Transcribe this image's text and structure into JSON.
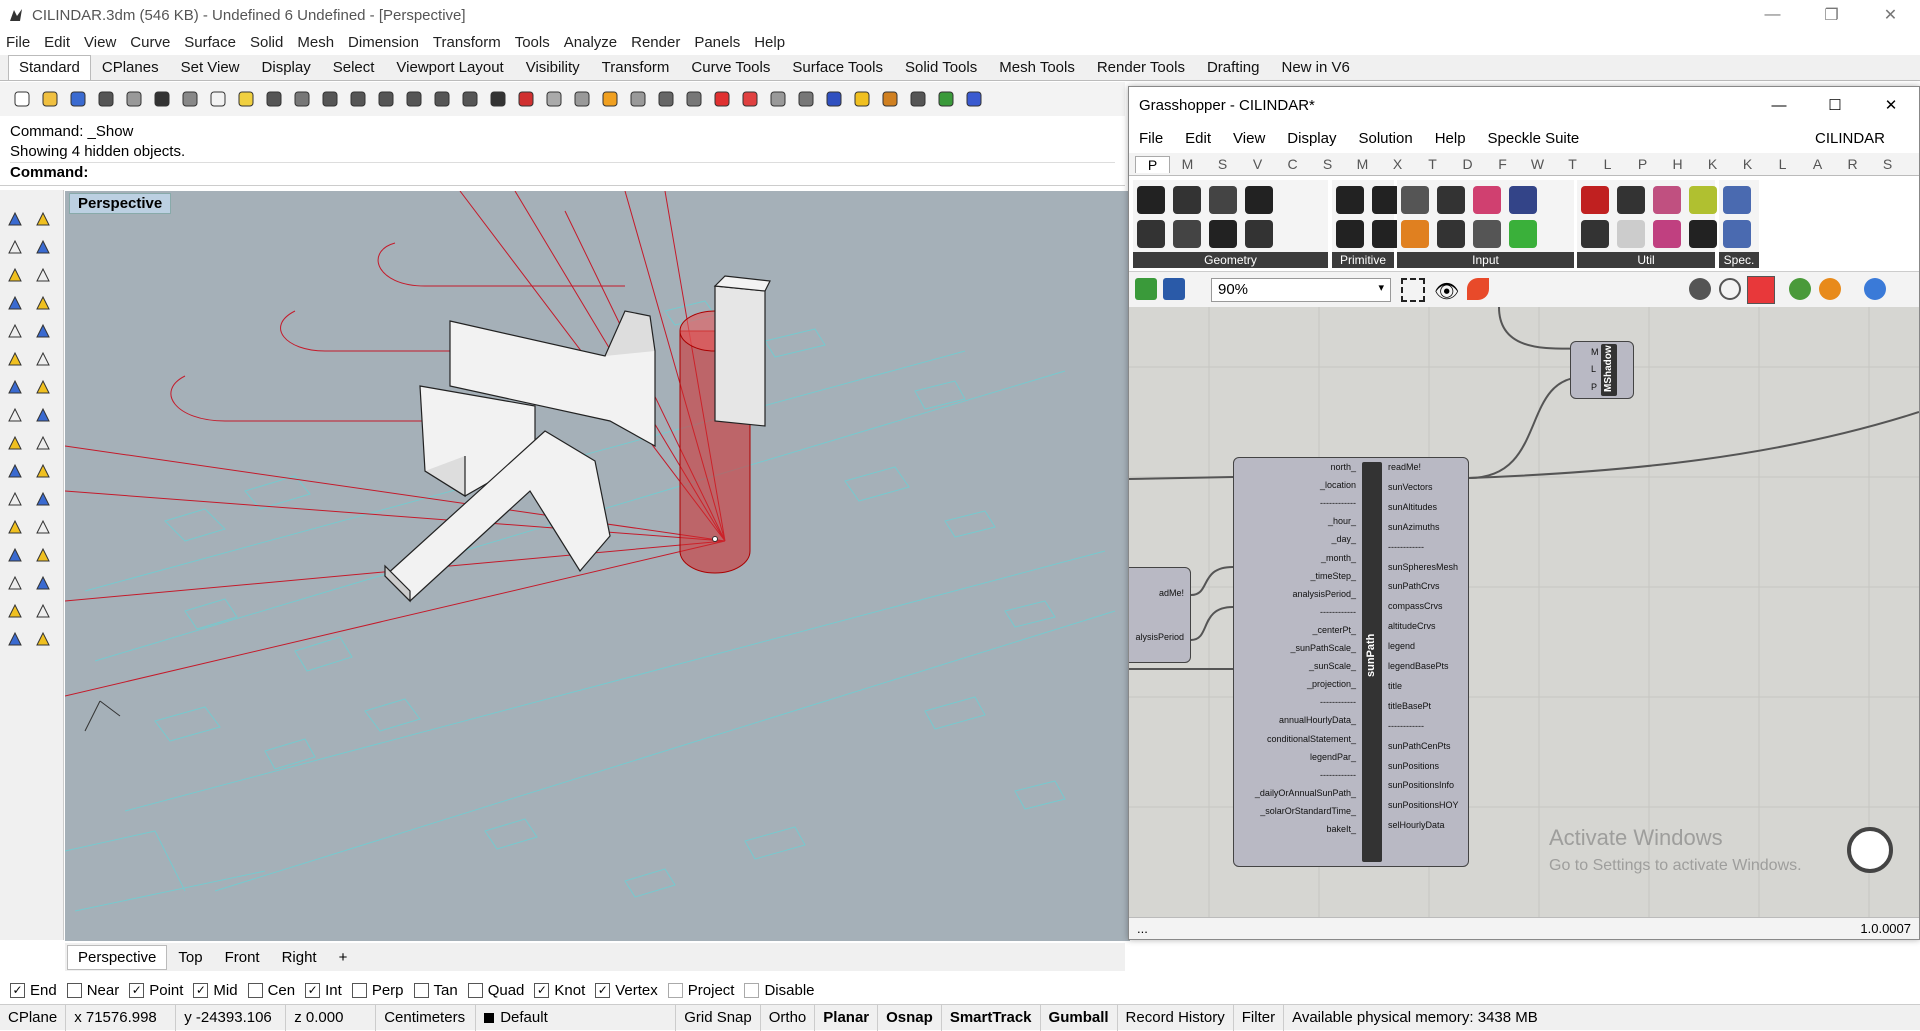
{
  "window": {
    "title": "CILINDAR.3dm (546 KB) - Undefined 6 Undefined - [Perspective]"
  },
  "menu": [
    "File",
    "Edit",
    "View",
    "Curve",
    "Surface",
    "Solid",
    "Mesh",
    "Dimension",
    "Transform",
    "Tools",
    "Analyze",
    "Render",
    "Panels",
    "Help"
  ],
  "tabs": [
    "Standard",
    "CPlanes",
    "Set View",
    "Display",
    "Select",
    "Viewport Layout",
    "Visibility",
    "Transform",
    "Curve Tools",
    "Surface Tools",
    "Solid Tools",
    "Mesh Tools",
    "Render Tools",
    "Drafting",
    "New in V6"
  ],
  "command": {
    "line1": "Command: _Show",
    "line2": "Showing 4 hidden objects.",
    "prompt": "Command:"
  },
  "viewport": {
    "label": "Perspective"
  },
  "viewport_tabs": [
    "Perspective",
    "Top",
    "Front",
    "Right",
    "+"
  ],
  "osnaps": [
    {
      "label": "End",
      "checked": true
    },
    {
      "label": "Near",
      "checked": false
    },
    {
      "label": "Point",
      "checked": true
    },
    {
      "label": "Mid",
      "checked": true
    },
    {
      "label": "Cen",
      "checked": false
    },
    {
      "label": "Int",
      "checked": true
    },
    {
      "label": "Perp",
      "checked": false
    },
    {
      "label": "Tan",
      "checked": false
    },
    {
      "label": "Quad",
      "checked": false
    },
    {
      "label": "Knot",
      "checked": true
    },
    {
      "label": "Vertex",
      "checked": true
    },
    {
      "label": "Project",
      "checked": false
    },
    {
      "label": "Disable",
      "checked": false
    }
  ],
  "status": {
    "cplane": "CPlane",
    "x": "x 71576.998",
    "y": "y -24393.106",
    "z": "z 0.000",
    "units": "Centimeters",
    "layer": "Default",
    "toggles": [
      "Grid Snap",
      "Ortho",
      "Planar",
      "Osnap",
      "SmartTrack",
      "Gumball",
      "Record History",
      "Filter"
    ],
    "bold_toggles": [
      "Planar",
      "Osnap",
      "SmartTrack",
      "Gumball"
    ],
    "memory": "Available physical memory: 3438 MB"
  },
  "grasshopper": {
    "title": "Grasshopper - CILINDAR*",
    "menu": [
      "File",
      "Edit",
      "View",
      "Display",
      "Solution",
      "Help",
      "Speckle Suite"
    ],
    "doc": "CILINDAR",
    "category_tabs": [
      "P",
      "M",
      "S",
      "V",
      "C",
      "S",
      "M",
      "X",
      "T",
      "D",
      "F",
      "W",
      "T",
      "L",
      "P",
      "H",
      "K",
      "K",
      "L",
      "A",
      "R",
      "S"
    ],
    "ribbon_groups": [
      "Geometry",
      "Primitive",
      "Input",
      "Util",
      "Spec."
    ],
    "zoom": "90%",
    "version": "1.0.0007",
    "footer_left": "...",
    "sunpath": {
      "name": "sunPath",
      "inputs": [
        "north_",
        "_location",
        "------------",
        "_hour_",
        "_day_",
        "_month_",
        "_timeStep_",
        "analysisPeriod_",
        "------------",
        "_centerPt_",
        "_sunPathScale_",
        "_sunScale_",
        "_projection_",
        "------------",
        "annualHourlyData_",
        "conditionalStatement_",
        "legendPar_",
        "------------",
        "_dailyOrAnnualSunPath_",
        "_solarOrStandardTime_",
        "bakeIt_"
      ],
      "outputs": [
        "readMe!",
        "sunVectors",
        "sunAltitudes",
        "sunAzimuths",
        "------------",
        "sunSpheresMesh",
        "sunPathCrvs",
        "compassCrvs",
        "altitudeCrvs",
        "legend",
        "legendBasePts",
        "title",
        "titleBasePt",
        "------------",
        "sunPathCenPts",
        "sunPositions",
        "sunPositionsInfo",
        "sunPositionsHOY",
        "selHourlyData"
      ]
    },
    "mshadow": {
      "name": "MShadow",
      "inputs": [
        "M",
        "L",
        "P"
      ]
    },
    "left_comp": {
      "outputs": [
        "adMe!",
        "alysisPeriod"
      ]
    }
  },
  "watermark": {
    "line1": "Activate Windows",
    "line2": "Go to Settings to activate Windows."
  }
}
